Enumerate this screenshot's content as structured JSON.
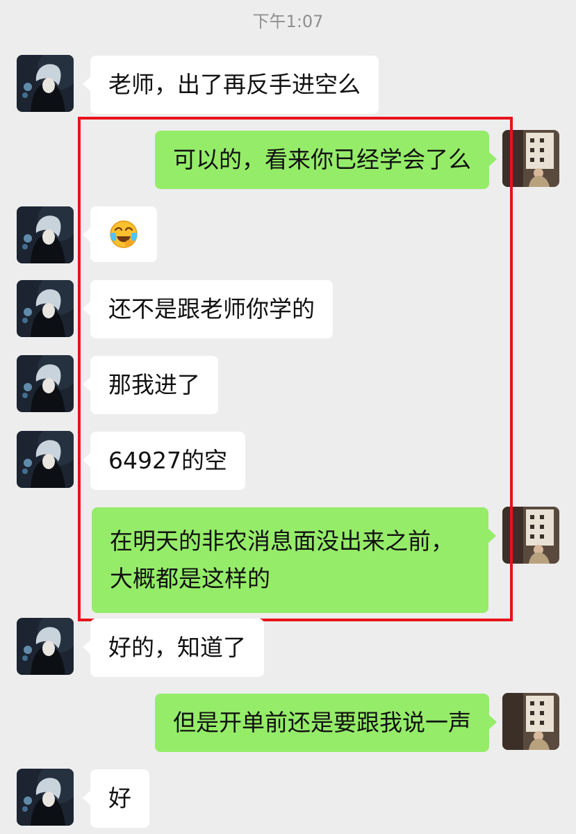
{
  "timestamp": "下午1:07",
  "colors": {
    "background": "#ededed",
    "incoming_bubble": "#ffffff",
    "outgoing_bubble": "#95ec69",
    "highlight_box": "#e8121a"
  },
  "messages": [
    {
      "sender": "student",
      "text": "老师，出了再反手进空么"
    },
    {
      "sender": "teacher",
      "text": "可以的，看来你已经学会了么"
    },
    {
      "sender": "student",
      "emoji": "face-with-tears-emoji"
    },
    {
      "sender": "student",
      "text": "还不是跟老师你学的"
    },
    {
      "sender": "student",
      "text": "那我进了"
    },
    {
      "sender": "student",
      "text": "64927的空"
    },
    {
      "sender": "teacher",
      "lines": [
        "在明天的非农消息面没出来之前，",
        "大概都是这样的"
      ]
    },
    {
      "sender": "student",
      "text": "好的，知道了"
    },
    {
      "sender": "teacher",
      "text": "但是开单前还是要跟我说一声"
    },
    {
      "sender": "student",
      "text": "好"
    }
  ]
}
